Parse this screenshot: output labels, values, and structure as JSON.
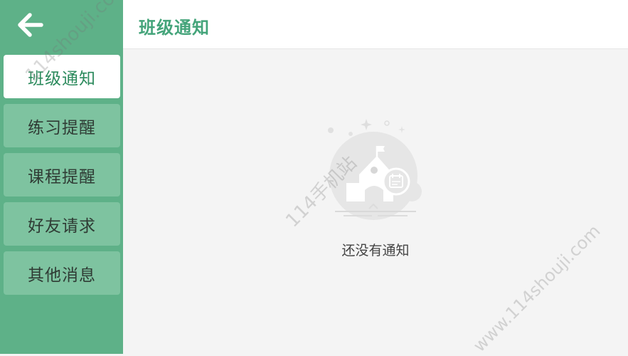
{
  "sidebar": {
    "back_icon": "arrow-left-icon",
    "items": [
      {
        "label": "班级通知",
        "active": true
      },
      {
        "label": "练习提醒",
        "active": false
      },
      {
        "label": "课程提醒",
        "active": false
      },
      {
        "label": "好友请求",
        "active": false
      },
      {
        "label": "其他消息",
        "active": false
      }
    ]
  },
  "header": {
    "title": "班级通知"
  },
  "main": {
    "empty_icon": "school-notice-illustration",
    "empty_text": "还没有通知"
  },
  "watermarks": [
    "114shouji.com",
    "114手机站",
    "www.114shouji.com"
  ],
  "colors": {
    "sidebar": "#5eb188",
    "item": "#7ec3a0",
    "active_item": "#ffffff",
    "accent": "#44a47a",
    "background": "#f4f4f4"
  }
}
